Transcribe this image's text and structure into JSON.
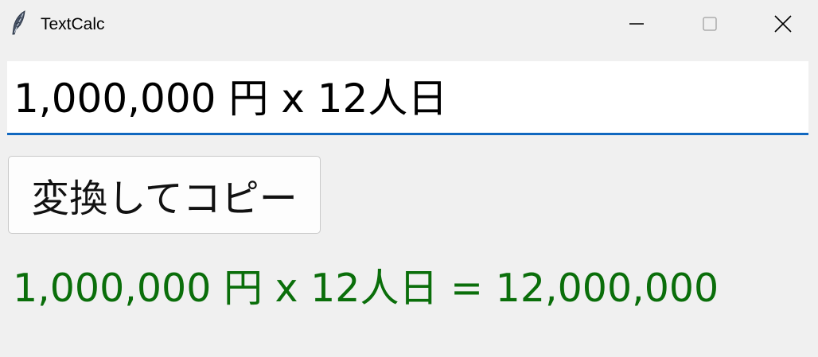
{
  "window": {
    "title": "TextCalc",
    "icon": "feather-icon",
    "controls": {
      "minimize_icon": "minimize-icon",
      "maximize_icon": "maximize-icon",
      "close_icon": "close-icon"
    }
  },
  "input": {
    "value": "1,000,000 円 x 12人日",
    "focus_color": "#1168c0"
  },
  "convert_button": {
    "label": "変換してコピー"
  },
  "result": {
    "text": "1,000,000 円 x 12人日 = 12,000,000",
    "color": "#0a6e0a"
  }
}
